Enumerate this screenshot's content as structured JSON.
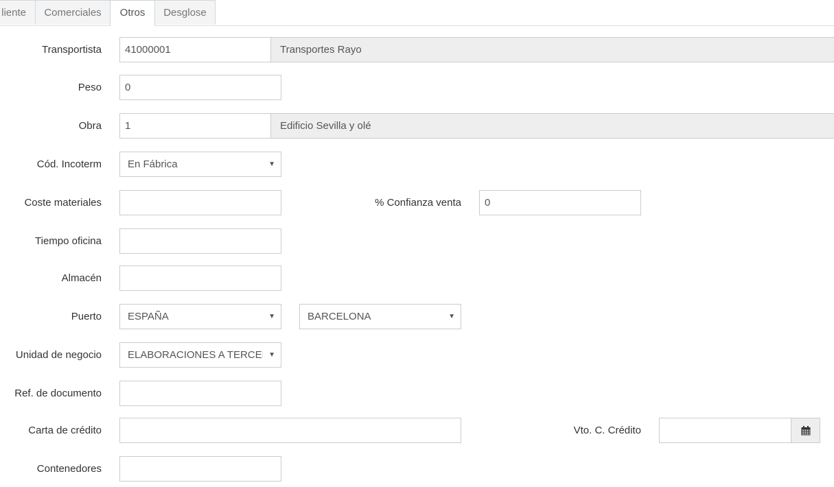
{
  "tabs": [
    {
      "label": "liente"
    },
    {
      "label": "Comerciales"
    },
    {
      "label": "Otros",
      "active": true
    },
    {
      "label": "Desglose"
    }
  ],
  "form": {
    "transportista": {
      "label": "Transportista",
      "code": "41000001",
      "name": "Transportes Rayo"
    },
    "peso": {
      "label": "Peso",
      "value": "0"
    },
    "obra": {
      "label": "Obra",
      "code": "1",
      "name": "Edificio Sevilla y olé"
    },
    "incoterm": {
      "label": "Cód. Incoterm",
      "selected": "En Fábrica"
    },
    "coste_materiales": {
      "label": "Coste materiales",
      "value": ""
    },
    "confianza_venta": {
      "label": "% Confianza venta",
      "value": "0"
    },
    "tiempo_oficina": {
      "label": "Tiempo oficina",
      "value": ""
    },
    "almacen": {
      "label": "Almacén",
      "value": ""
    },
    "puerto": {
      "label": "Puerto",
      "country": "ESPAÑA",
      "port": "BARCELONA"
    },
    "unidad_negocio": {
      "label": "Unidad de negocio",
      "selected": "ELABORACIONES A TERCEROS"
    },
    "ref_documento": {
      "label": "Ref. de documento",
      "value": ""
    },
    "carta_credito": {
      "label": "Carta de crédito",
      "value": ""
    },
    "vto_credito": {
      "label": "Vto. C. Crédito",
      "value": ""
    },
    "contenedores": {
      "label": "Contenedores",
      "value": ""
    }
  },
  "icons": {
    "caret": "caret-down-icon",
    "calendar": "calendar-icon"
  },
  "colors": {
    "tab_border": "#cfd8e0",
    "readonly_bg": "#eeeeee",
    "input_border": "#cccccc"
  }
}
